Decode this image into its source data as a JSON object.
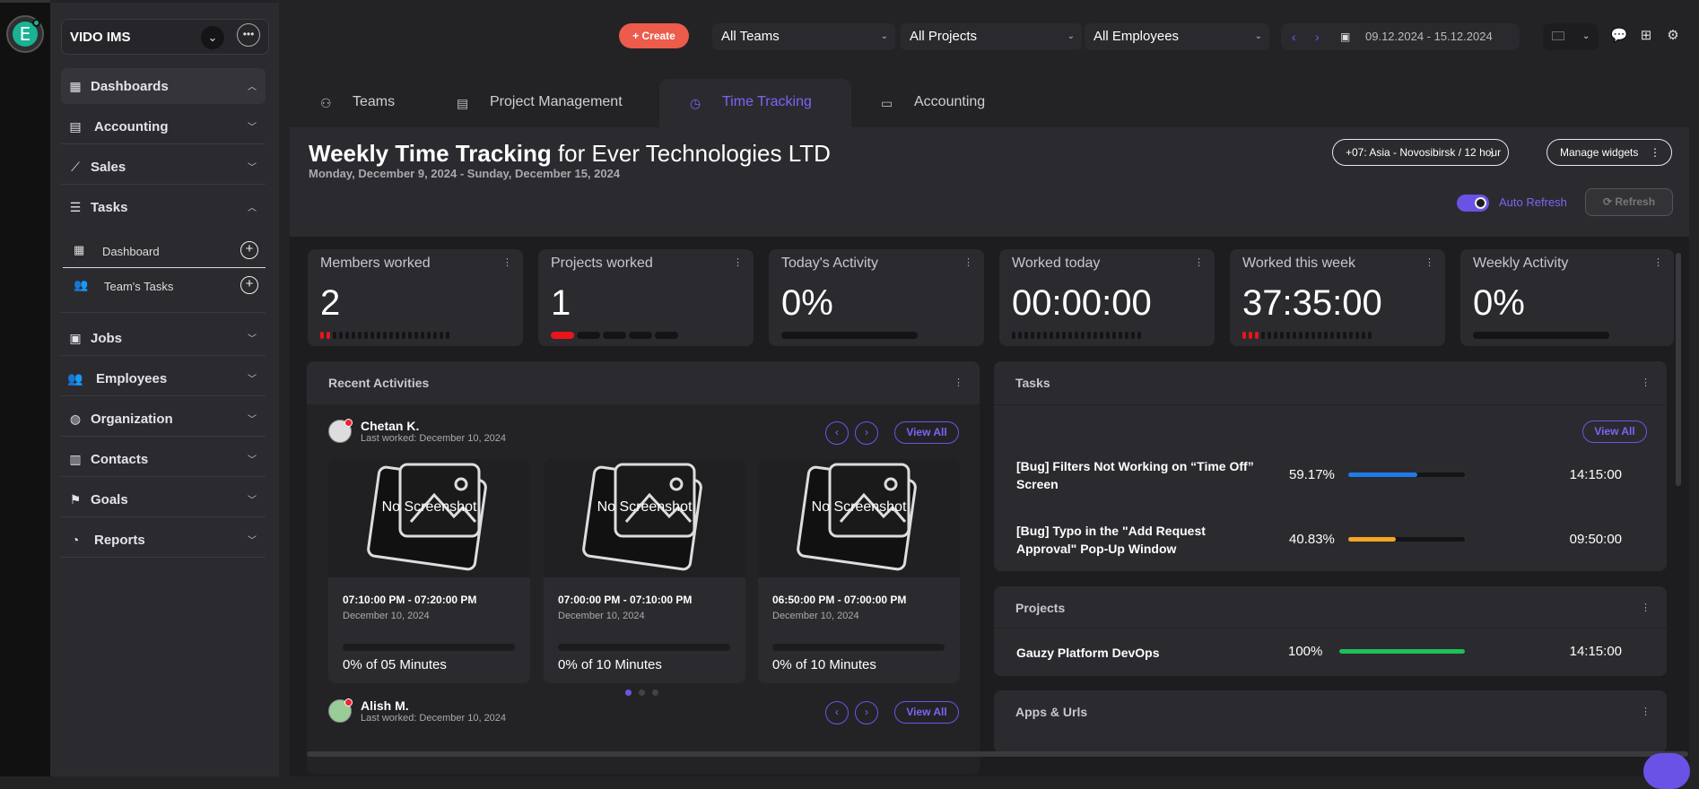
{
  "app": {
    "brand": "VIDO IMS",
    "avatar_letter": "E"
  },
  "sidebar": {
    "items": [
      {
        "label": "Dashboards",
        "icon": "grid-icon"
      },
      {
        "label": "Accounting",
        "icon": "id-card-icon"
      },
      {
        "label": "Sales",
        "icon": "chart-line-icon"
      },
      {
        "label": "Tasks",
        "icon": "list-check-icon"
      },
      {
        "label": "Jobs",
        "icon": "briefcase-icon"
      },
      {
        "label": "Employees",
        "icon": "users-icon"
      },
      {
        "label": "Organization",
        "icon": "globe-icon"
      },
      {
        "label": "Contacts",
        "icon": "address-book-icon"
      },
      {
        "label": "Goals",
        "icon": "flag-icon"
      },
      {
        "label": "Reports",
        "icon": "pie-chart-icon"
      }
    ],
    "tasks_sub": [
      {
        "label": "Dashboard",
        "icon": "grid-icon"
      },
      {
        "label": "Team's Tasks",
        "icon": "users-icon"
      }
    ]
  },
  "topbar": {
    "create_label": "+ Create",
    "teams": "All Teams",
    "projects": "All Projects",
    "employees": "All Employees",
    "date_range": "09.12.2024 - 15.12.2024"
  },
  "tabs": [
    {
      "label": "Teams",
      "icon": "users-icon"
    },
    {
      "label": "Project Management",
      "icon": "calendar-icon"
    },
    {
      "label": "Time Tracking",
      "icon": "clock-icon"
    },
    {
      "label": "Accounting",
      "icon": "credit-card-icon"
    }
  ],
  "page": {
    "title_bold": "Weekly Time Tracking",
    "title_rest": " for Ever Technologies LTD",
    "subtitle": "Monday, December 9, 2024 - Sunday, December 15, 2024",
    "timezone": "+07: Asia - Novosibirsk / 12 hour",
    "manage_widgets": "Manage widgets",
    "auto_refresh": "Auto Refresh",
    "refresh": "Refresh"
  },
  "stats": [
    {
      "label": "Members worked",
      "value": "2"
    },
    {
      "label": "Projects worked",
      "value": "1"
    },
    {
      "label": "Today's Activity",
      "value": "0%"
    },
    {
      "label": "Worked today",
      "value": "00:00:00"
    },
    {
      "label": "Worked this week",
      "value": "37:35:00"
    },
    {
      "label": "Weekly Activity",
      "value": "0%"
    }
  ],
  "recent": {
    "title": "Recent Activities",
    "view_all": "View All",
    "no_screenshot": "No Screenshot",
    "users": [
      {
        "name": "Chetan K.",
        "last_worked": "Last worked: December 10, 2024"
      },
      {
        "name": "Alish M.",
        "last_worked": "Last worked: December 10, 2024"
      }
    ],
    "cards": [
      {
        "time": "07:10:00 PM - 07:20:00 PM",
        "date": "December 10, 2024",
        "percent": "0% of 05 Minutes"
      },
      {
        "time": "07:00:00 PM - 07:10:00 PM",
        "date": "December 10, 2024",
        "percent": "0% of 10 Minutes"
      },
      {
        "time": "06:50:00 PM - 07:00:00 PM",
        "date": "December 10, 2024",
        "percent": "0% of 10 Minutes"
      }
    ]
  },
  "tasks_panel": {
    "title": "Tasks",
    "view_all": "View All",
    "rows": [
      {
        "name": "[Bug] Filters Not Working on “Time Off” Screen",
        "percent": "59.17%",
        "time": "14:15:00",
        "fill": 0.5917,
        "color": "#1f7be8"
      },
      {
        "name": "[Bug] Typo in the \"Add Request Approval\" Pop-Up Window",
        "percent": "40.83%",
        "time": "09:50:00",
        "fill": 0.4083,
        "color": "#f5a623"
      }
    ]
  },
  "projects_panel": {
    "title": "Projects",
    "rows": [
      {
        "name": "Gauzy Platform DevOps",
        "percent": "100%",
        "time": "14:15:00",
        "fill": 1.0,
        "color": "#1fc05a"
      }
    ]
  },
  "apps_panel": {
    "title": "Apps & Urls"
  },
  "colors": {
    "accent": "#7c64f6",
    "create": "#ec5b4b",
    "alert": "#e8151b"
  }
}
